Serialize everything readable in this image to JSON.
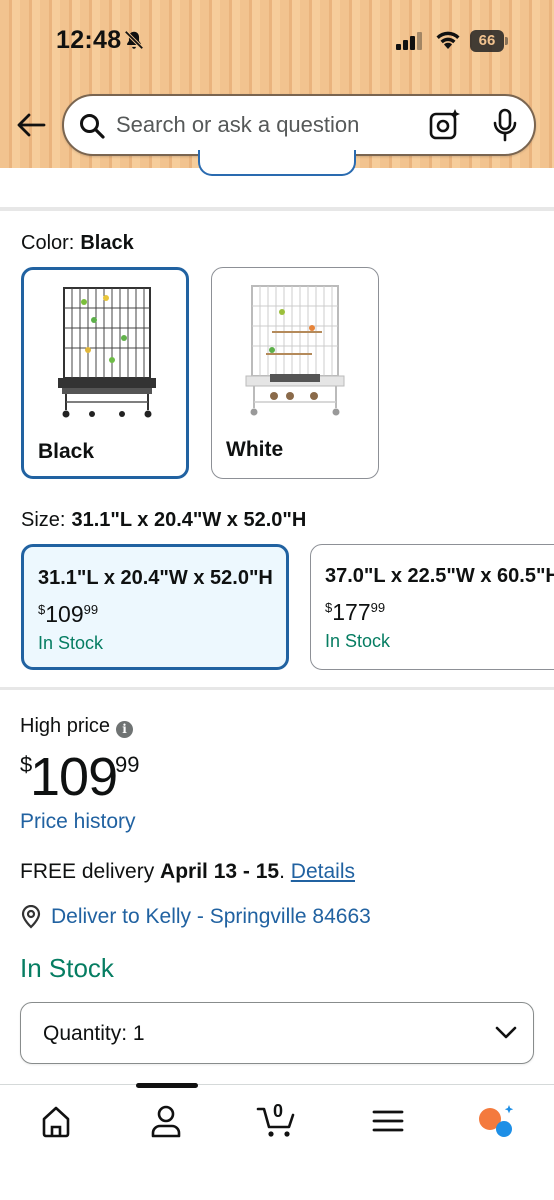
{
  "status_bar": {
    "time": "12:48",
    "battery": "66"
  },
  "search": {
    "placeholder": "Search or ask a question"
  },
  "color": {
    "label": "Color:",
    "selected": "Black",
    "options": [
      {
        "name": "Black",
        "selected": true
      },
      {
        "name": "White",
        "selected": false
      }
    ]
  },
  "size": {
    "label": "Size:",
    "selected": "31.1\"L x 20.4\"W x 52.0\"H",
    "options": [
      {
        "dims": "31.1\"L x 20.4\"W x 52.0\"H",
        "price_whole": "109",
        "price_frac": "99",
        "currency": "$",
        "stock": "In Stock",
        "selected": true
      },
      {
        "dims": "37.0\"L x 22.5\"W x 60.5\"H",
        "price_whole": "177",
        "price_frac": "99",
        "currency": "$",
        "stock": "In Stock",
        "selected": false
      }
    ]
  },
  "pricing": {
    "label": "High price",
    "info_glyph": "i",
    "currency": "$",
    "whole": "109",
    "fraction": "99",
    "history_link": "Price history"
  },
  "delivery": {
    "prefix": "FREE delivery",
    "dates": "April 13 - 15",
    "separator": ".",
    "details_link": "Details",
    "deliver_to": "Deliver to Kelly - Springville 84663"
  },
  "availability": "In Stock",
  "quantity": {
    "label": "Quantity: 1"
  },
  "bottom_nav": {
    "cart_count": "0",
    "items": [
      "home-icon",
      "account-icon",
      "cart-icon",
      "menu-icon",
      "rufus-icon"
    ]
  },
  "colors": {
    "accent_blue": "#2162a1",
    "stock_green": "#067d62",
    "header_orange": "#f2c38f",
    "rufus_orange": "#f47a3d",
    "rufus_blue": "#1e8fe6"
  }
}
